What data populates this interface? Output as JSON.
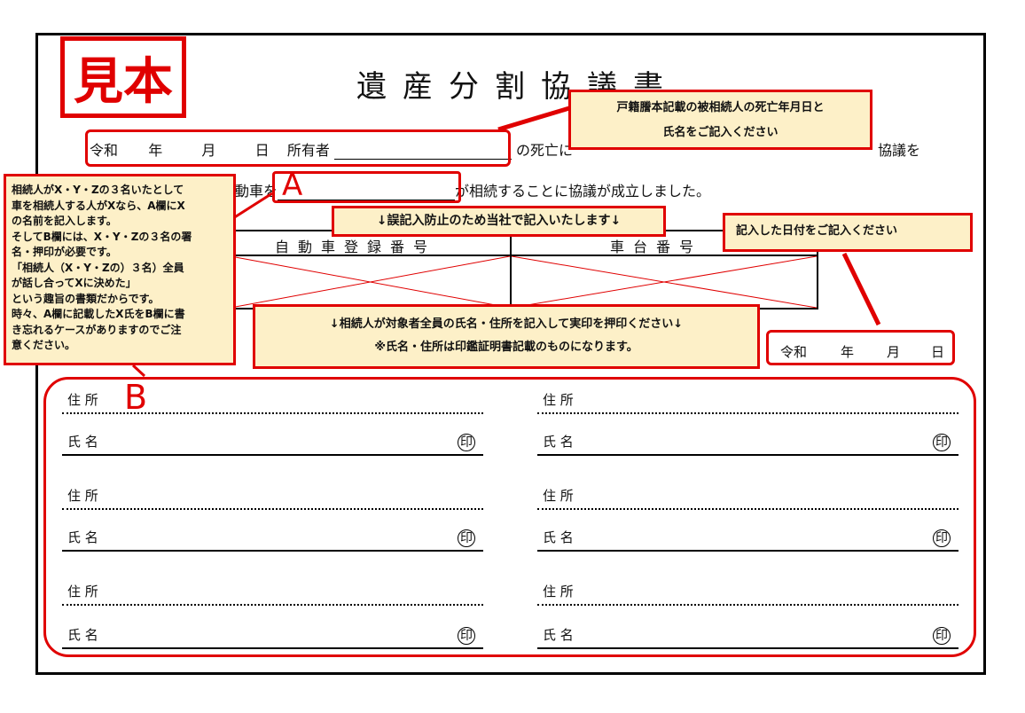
{
  "document": {
    "stamp": "見本",
    "title": "遺産分割協議書",
    "line1": {
      "era": "令和",
      "year": "年",
      "month": "月",
      "day": "日",
      "owner_label": "所有者",
      "after": "の死亡に",
      "end": "協議を"
    },
    "line2": {
      "lead": "動車を",
      "after": "が相続することに協議が成立しました。"
    },
    "table": {
      "col1": "自動車登録番号",
      "col2": "車台番号"
    },
    "date_box": {
      "era": "令和",
      "year": "年",
      "month": "月",
      "day": "日"
    },
    "signatures": {
      "address_label": "住 所",
      "name_label": "氏 名",
      "seal": "印"
    }
  },
  "annotations": {
    "note_top": [
      "戸籍謄本記載の被相続人の死亡年月日と",
      "氏名をご記入ください"
    ],
    "note_left": [
      "相続人がX・Y・Zの３名いたとして",
      "車を相続人する人がXなら、A欄にX",
      "の名前を記入します。",
      "そしてB欄には、X・Y・Zの３名の署",
      "名・押印が必要です。",
      "「相続人（X・Y・Zの）３名）全員",
      "が話し合ってXに決めた」",
      "という趣旨の書類だからです。",
      "時々、A欄に記載したX氏をB欄に書",
      "き忘れるケースがありますのでご注",
      "意ください。"
    ],
    "note_mid": "↓誤記入防止のため当社で記入いたします↓",
    "note_date": "記入した日付をご記入ください",
    "note_sign": [
      "↓相続人が対象者全員の氏名・住所を記入して実印を押印ください↓",
      "※氏名・住所は印鑑証明書記載のものになります。"
    ],
    "label_a": "A",
    "label_b": "B"
  },
  "colors": {
    "red": "#e00000",
    "note_bg": "#fdf0c8"
  }
}
